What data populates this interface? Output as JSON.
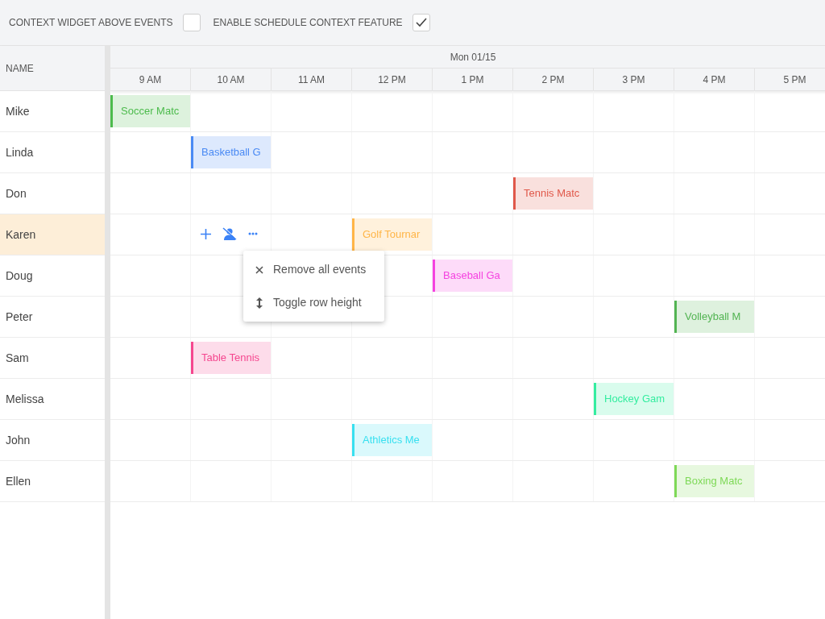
{
  "toolbar": {
    "options": [
      {
        "label": "CONTEXT WIDGET ABOVE EVENTS",
        "checked": false
      },
      {
        "label": "ENABLE SCHEDULE CONTEXT FEATURE",
        "checked": true
      }
    ]
  },
  "schedule": {
    "name_header": "NAME",
    "date": "Mon 01/15",
    "hours": [
      "9 AM",
      "10 AM",
      "11 AM",
      "12 PM",
      "1 PM",
      "2 PM",
      "3 PM",
      "4 PM",
      "5 PM"
    ],
    "rows": [
      {
        "name": "Mike",
        "selected": false,
        "cells": [
          {
            "kind": "event",
            "title": "Soccer Matc",
            "color": "#4cbb4c"
          }
        ]
      },
      {
        "name": "Linda",
        "selected": false,
        "cells": [
          {
            "kind": "empty"
          },
          {
            "kind": "event",
            "title": "Basketball G",
            "color": "#4a8af4"
          }
        ]
      },
      {
        "name": "Don",
        "selected": false,
        "cells": [
          {
            "kind": "empty"
          },
          {
            "kind": "empty"
          },
          {
            "kind": "empty"
          },
          {
            "kind": "empty"
          },
          {
            "kind": "empty"
          },
          {
            "kind": "event",
            "title": "Tennis Matc",
            "color": "#e0584a"
          }
        ]
      },
      {
        "name": "Karen",
        "selected": true,
        "cells": [
          {
            "kind": "empty"
          },
          {
            "kind": "empty"
          },
          {
            "kind": "empty"
          },
          {
            "kind": "event",
            "title": "Golf Tournar",
            "color": "#ffb547"
          }
        ]
      },
      {
        "name": "Doug",
        "selected": false,
        "cells": [
          {
            "kind": "empty"
          },
          {
            "kind": "empty"
          },
          {
            "kind": "empty"
          },
          {
            "kind": "empty"
          },
          {
            "kind": "event",
            "title": "Baseball Ga",
            "color": "#f542e0"
          }
        ]
      },
      {
        "name": "Peter",
        "selected": false,
        "cells": [
          {
            "kind": "empty"
          },
          {
            "kind": "empty"
          },
          {
            "kind": "empty"
          },
          {
            "kind": "empty"
          },
          {
            "kind": "empty"
          },
          {
            "kind": "empty"
          },
          {
            "kind": "empty"
          },
          {
            "kind": "event",
            "title": "Volleyball M",
            "color": "#52b452"
          }
        ]
      },
      {
        "name": "Sam",
        "selected": false,
        "cells": [
          {
            "kind": "empty"
          },
          {
            "kind": "event",
            "title": "Table Tennis",
            "color": "#f5478f"
          }
        ]
      },
      {
        "name": "Melissa",
        "selected": false,
        "cells": [
          {
            "kind": "empty"
          },
          {
            "kind": "empty"
          },
          {
            "kind": "empty"
          },
          {
            "kind": "empty"
          },
          {
            "kind": "empty"
          },
          {
            "kind": "empty"
          },
          {
            "kind": "event",
            "title": "Hockey Gam",
            "color": "#34eda0"
          }
        ]
      },
      {
        "name": "John",
        "selected": false,
        "cells": [
          {
            "kind": "empty"
          },
          {
            "kind": "empty"
          },
          {
            "kind": "empty"
          },
          {
            "kind": "event",
            "title": "Athletics Me",
            "color": "#38e0f0"
          }
        ]
      },
      {
        "name": "Ellen",
        "selected": false,
        "cells": [
          {
            "kind": "empty"
          },
          {
            "kind": "empty"
          },
          {
            "kind": "empty"
          },
          {
            "kind": "empty"
          },
          {
            "kind": "empty"
          },
          {
            "kind": "empty"
          },
          {
            "kind": "empty"
          },
          {
            "kind": "event",
            "title": "Boxing Matc",
            "color": "#7ed957"
          }
        ]
      }
    ]
  },
  "context_menu": {
    "items": [
      {
        "kind": "remove",
        "label": "Remove all events"
      },
      {
        "kind": "resize",
        "label": "Toggle row height"
      }
    ]
  }
}
